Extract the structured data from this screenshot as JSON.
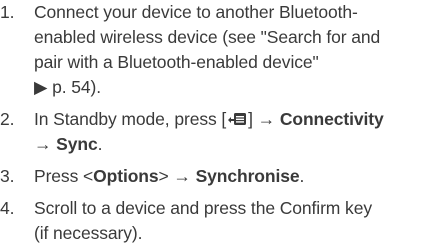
{
  "steps": [
    {
      "number": "1.",
      "lines": [
        "Connect your device to another Bluetooth-",
        "enabled wireless device (see \"Search for and",
        "pair with a Bluetooth-enabled device\"",
        "▶ p. 54)."
      ]
    },
    {
      "number": "2.",
      "line1": {
        "prefix": "In Standby mode, press [",
        "key_icon": "menu-key-icon",
        "suffix": "] → ",
        "bold": "Connectivity"
      },
      "line2": {
        "prefix": "→ ",
        "bold": "Sync",
        "suffix": "."
      }
    },
    {
      "number": "3.",
      "line1": {
        "prefix": "Press <",
        "bold1": "Options",
        "middle": "> → ",
        "bold2": "Synchronise",
        "suffix": "."
      }
    },
    {
      "number": "4.",
      "lines": [
        "Scroll to a device and press the Confirm key",
        "(if necessary)."
      ]
    }
  ]
}
